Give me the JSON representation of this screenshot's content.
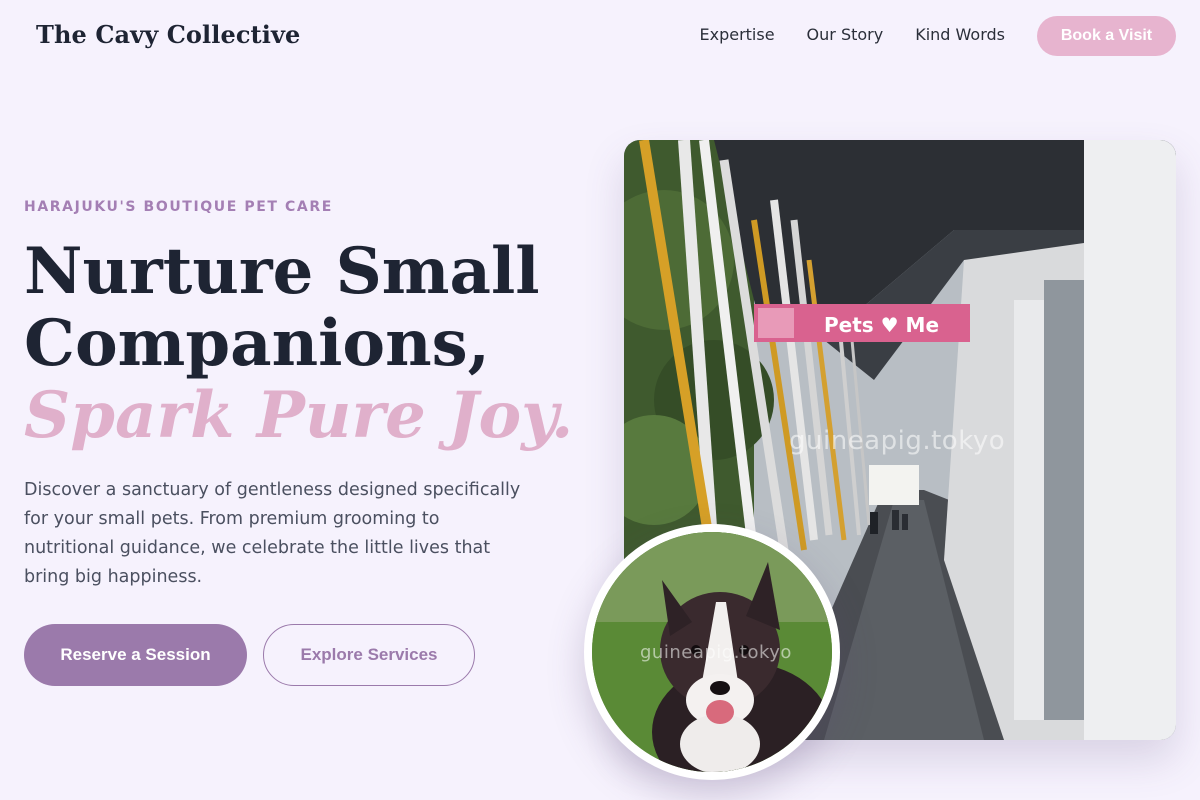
{
  "header": {
    "brand": "The Cavy Collective",
    "nav": [
      "Expertise",
      "Our Story",
      "Kind Words"
    ],
    "cta": "Book a Visit"
  },
  "hero": {
    "eyebrow": "HARAJUKU'S BOUTIQUE PET CARE",
    "headline_line1": "Nurture Small",
    "headline_line2": "Companions,",
    "headline_accent": "Spark Pure Joy.",
    "description": "Discover a sanctuary of gentleness designed specifically for your small pets. From premium grooming to nutritional guidance, we celebrate the little lives that bring big happiness.",
    "primary_button": "Reserve a Session",
    "secondary_button": "Explore Services"
  },
  "images": {
    "main_watermark": "guineapig.tokyo",
    "main_sign": "Pets ♥ Me",
    "dog_watermark": "guineapig.tokyo"
  },
  "colors": {
    "background": "#f6f2fd",
    "accent_pink": "#e7b4cf",
    "accent_purple": "#9b7aab",
    "eyebrow": "#a47fb4"
  }
}
